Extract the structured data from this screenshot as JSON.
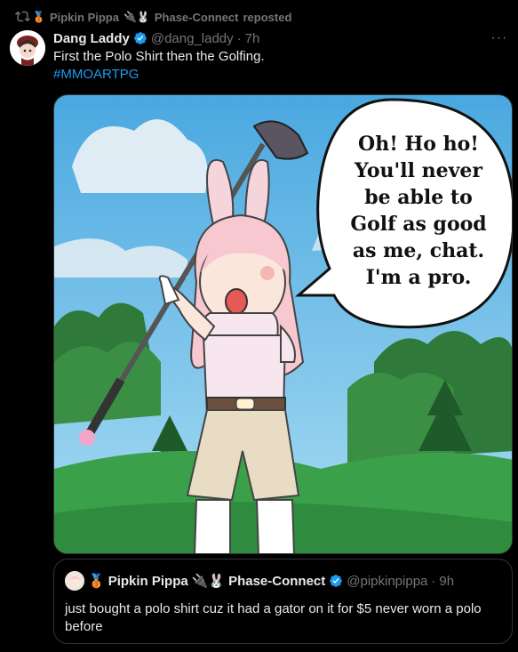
{
  "repost": {
    "user": "Pipkin Pippa",
    "emoji": "🥉 ",
    "partner_emoji": "🔌🐰",
    "partner": "Phase-Connect",
    "suffix": "reposted",
    "icon": "repost-icon"
  },
  "tweet": {
    "display_name": "Dang Laddy",
    "handle": "@dang_laddy",
    "separator": "·",
    "time": "7h",
    "text": "First the Polo Shirt then the Golfing.",
    "hashtag": "#MMOARTPG",
    "more_label": "···"
  },
  "image": {
    "speech_lines": [
      "Oh! Ho ho!",
      "You'll never",
      "be able to",
      "Golf as good",
      "as me, chat.",
      "I'm a pro."
    ]
  },
  "quote": {
    "emoji": "🥉",
    "display_name": "Pipkin Pippa",
    "partner_emoji": "🔌🐰",
    "partner": "Phase-Connect",
    "handle": "@pipkinpippa",
    "separator": "·",
    "time": "9h",
    "text": "just bought a polo shirt cuz it had a gator on it for $5 never worn a polo before"
  },
  "colors": {
    "background": "#000000",
    "text": "#e7e9ea",
    "secondary": "#71767b",
    "link": "#1d9bf0",
    "verified": "#1d9bf0"
  }
}
